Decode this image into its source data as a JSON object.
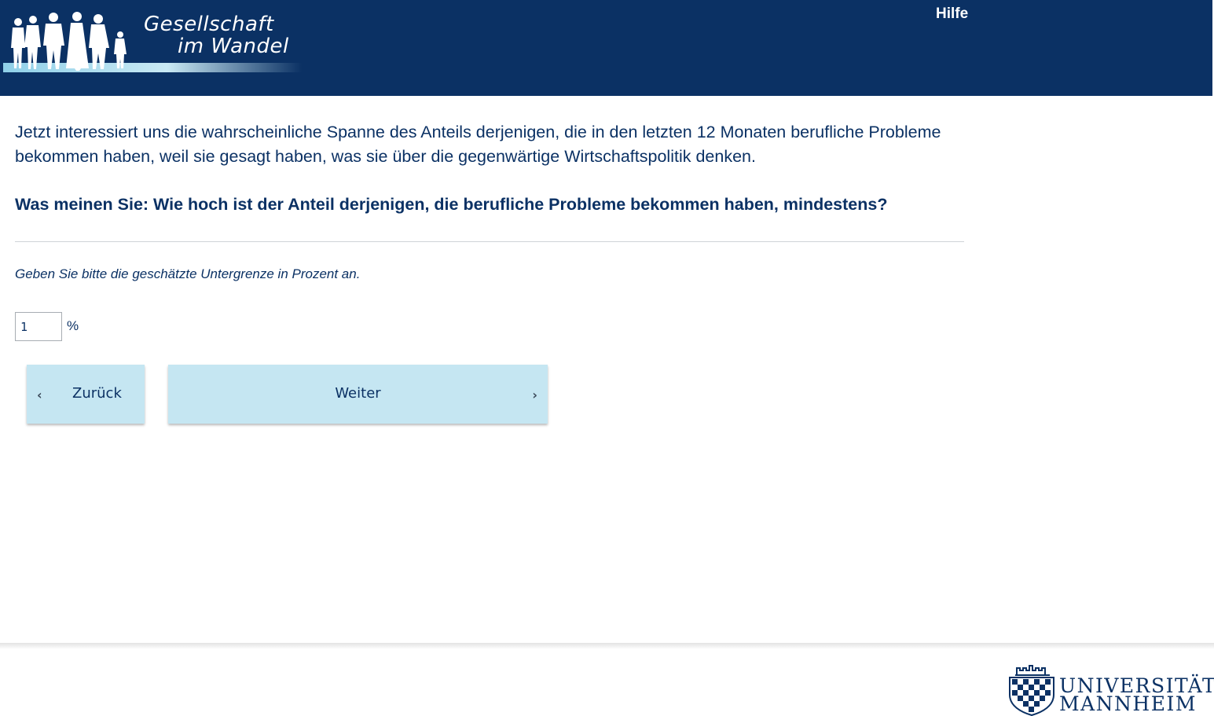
{
  "header": {
    "logo": {
      "line1": "Gesellschaft",
      "line2": "im Wandel",
      "icon": "people-silhouettes-icon"
    },
    "help_label": "Hilfe",
    "background_color": "#0b3164"
  },
  "main": {
    "intro_text": "Jetzt interessiert uns die wahrscheinliche Spanne des Anteils derjenigen, die in den letzten 12 Monaten berufliche Probleme bekommen haben, weil sie gesagt haben, was sie über die gegenwärtige Wirtschaftspolitik denken.",
    "question": "Was meinen Sie: Wie hoch ist der Anteil derjenigen, die berufliche Probleme bekommen haben, mindestens?",
    "instruction": "Geben Sie bitte die geschätzte Untergrenze in Prozent an.",
    "input": {
      "value": "1",
      "unit": "%"
    },
    "buttons": {
      "back_label": "Zurück",
      "back_icon": "chevron-left-icon",
      "next_label": "Weiter",
      "next_icon": "chevron-right-icon",
      "color": "#c5e6f2"
    }
  },
  "footer": {
    "university_logo": {
      "line1": "UNIVERSITÄT",
      "line2": "MANNHEIM",
      "icon": "university-crest-icon"
    }
  }
}
